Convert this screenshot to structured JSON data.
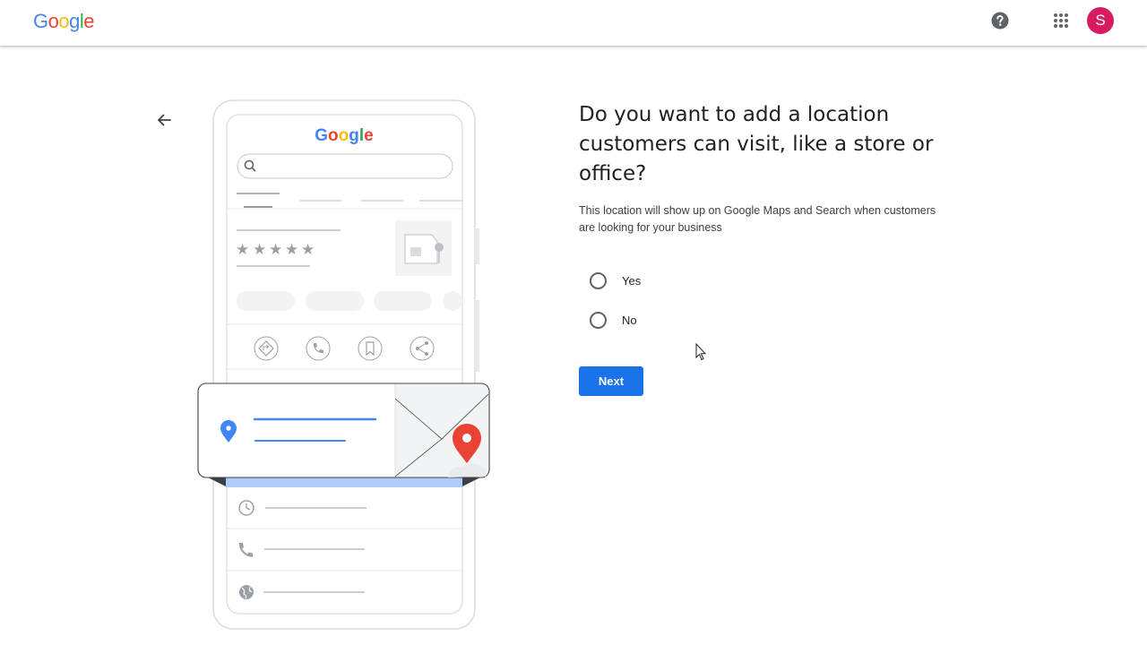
{
  "header": {
    "logo_letters": [
      "G",
      "o",
      "o",
      "g",
      "l",
      "e"
    ],
    "logo_colors": [
      "#4285F4",
      "#EA4335",
      "#FBBC05",
      "#4285F4",
      "#34A853",
      "#EA4335"
    ],
    "avatar_initial": "S",
    "avatar_color": "#d81b60",
    "icons": [
      "help-icon",
      "apps-icon"
    ]
  },
  "illustration": {
    "phone_logo": "Google",
    "rating_stars": 5,
    "action_icons": [
      "directions-icon",
      "phone-icon",
      "bookmark-icon",
      "share-icon"
    ],
    "detail_icons": [
      "clock-icon",
      "phone-icon",
      "globe-icon"
    ],
    "pin_colors": {
      "blue": "#4285F4",
      "red": "#EA4335"
    }
  },
  "form": {
    "question": "Do you want to add a location customers can visit, like a store or office?",
    "subtitle": "This location will show up on Google Maps and Search when customers are looking for your business",
    "options": [
      {
        "label": "Yes",
        "selected": false
      },
      {
        "label": "No",
        "selected": false
      }
    ],
    "next_label": "Next",
    "accent": "#1a73e8"
  }
}
